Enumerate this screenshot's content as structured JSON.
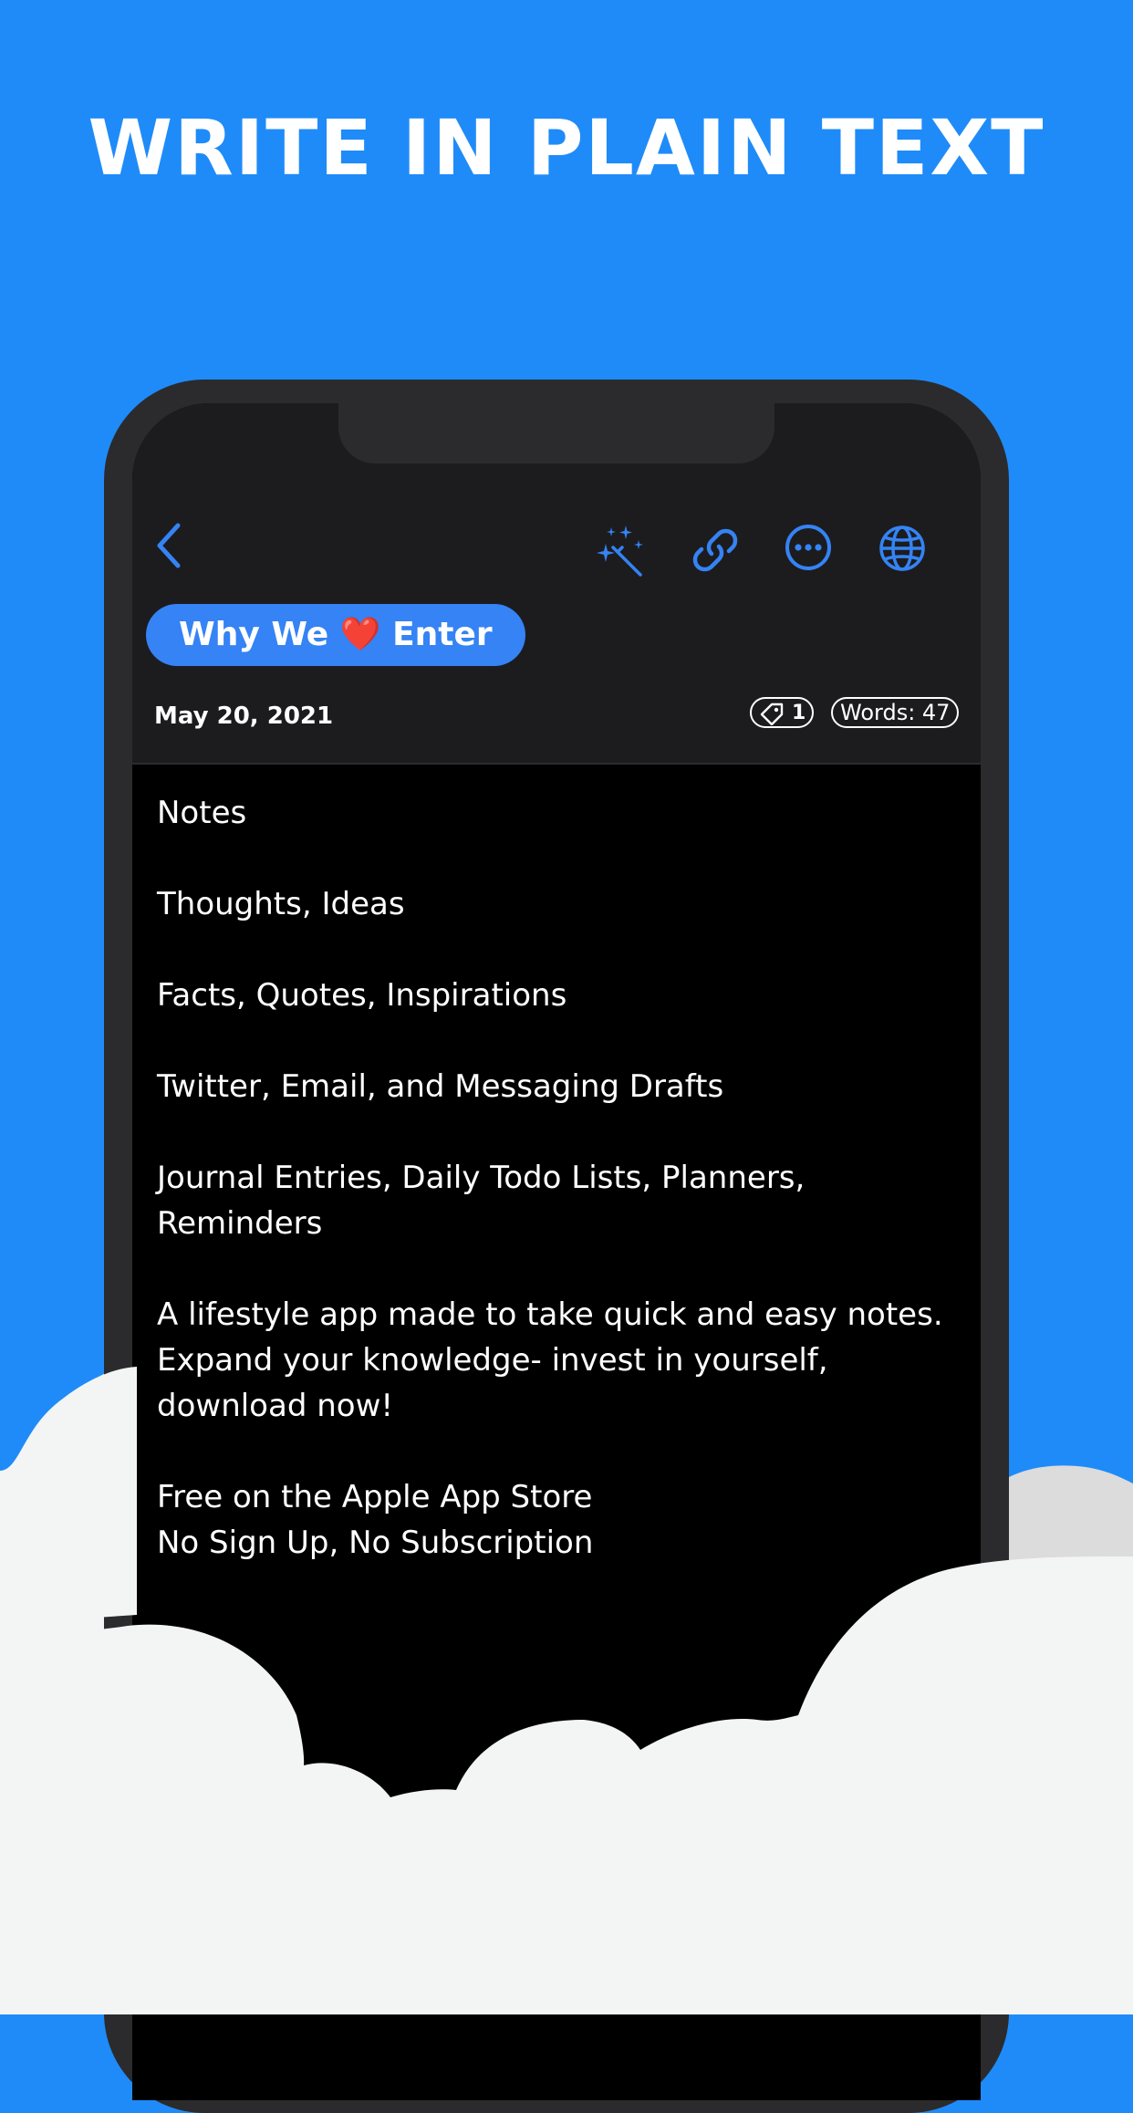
{
  "headline": "WRITE IN PLAIN TEXT",
  "toolbar": {
    "back_icon": "chevron-left-icon",
    "magic_icon": "magic-wand-icon",
    "link_icon": "link-icon",
    "more_icon": "ellipsis-circle-icon",
    "globe_icon": "globe-icon"
  },
  "note": {
    "title_before": "Why We ",
    "title_heart": "❤️",
    "title_after": " Enter",
    "date": "May 20, 2021",
    "tag_count": "1",
    "words": "Words: 47",
    "paragraphs": [
      "Notes",
      "Thoughts, Ideas",
      "Facts, Quotes, Inspirations",
      "Twitter, Email, and Messaging Drafts",
      "Journal Entries, Daily Todo Lists, Planners,\nReminders",
      "A lifestyle app made to take quick and easy notes.\nExpand your knowledge- invest in yourself,\ndownload now!",
      "Free on the Apple App Store\nNo Sign Up, No Subscription"
    ]
  },
  "colors": {
    "background_blue": "#1f8bf8",
    "accent_blue": "#3583f4",
    "cloud_white": "#f3f5f5",
    "cloud_grey": "#dcdcdc",
    "phone_frame": "#2b2b2d"
  }
}
